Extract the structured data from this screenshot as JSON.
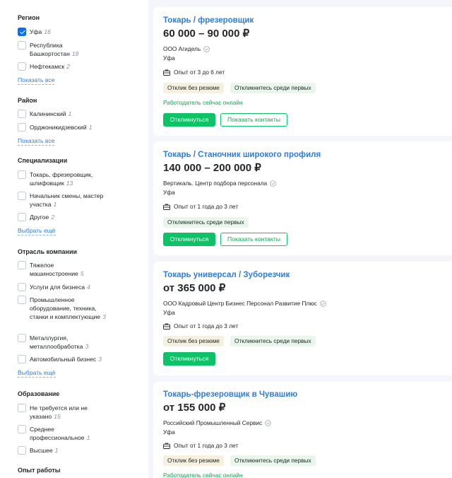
{
  "filters": {
    "region": {
      "title": "Регион",
      "options": [
        {
          "label": "Уфа",
          "count": "16",
          "checked": true
        },
        {
          "label": "Республика Башкортостан",
          "count": "18",
          "checked": false
        },
        {
          "label": "Нефтекамск",
          "count": "2",
          "checked": false
        }
      ],
      "more_label": "Показать все"
    },
    "district": {
      "title": "Район",
      "options": [
        {
          "label": "Калининский",
          "count": "1",
          "checked": false
        },
        {
          "label": "Орджоникидзевский",
          "count": "1",
          "checked": false
        }
      ],
      "more_label": "Показать все"
    },
    "specialization": {
      "title": "Специализации",
      "options": [
        {
          "label": "Токарь, фрезеровщик, шлифовщик",
          "count": "13",
          "checked": false
        },
        {
          "label": "Начальник смены, мастер участка",
          "count": "1",
          "checked": false
        },
        {
          "label": "Другое",
          "count": "2",
          "checked": false
        }
      ],
      "more_label": "Выбрать ещё"
    },
    "industry": {
      "title": "Отрасль компании",
      "options": [
        {
          "label": "Тяжелое машиностроение",
          "count": "5",
          "checked": false
        },
        {
          "label": "Услуги для бизнеса",
          "count": "4",
          "checked": false
        },
        {
          "label": "Промышленное оборудование, техника, станки и комплектующие",
          "count": "3",
          "checked": false
        },
        {
          "label": "Металлургия, металлообработка",
          "count": "3",
          "checked": false
        },
        {
          "label": "Автомобильный бизнес",
          "count": "3",
          "checked": false
        }
      ],
      "more_label": "Выбрать ещё"
    },
    "education": {
      "title": "Образование",
      "options": [
        {
          "label": "Не требуется или не указано",
          "count": "15",
          "checked": false
        },
        {
          "label": "Среднее профессиональное",
          "count": "1",
          "checked": false
        },
        {
          "label": "Высшее",
          "count": "1",
          "checked": false
        }
      ]
    },
    "experience": {
      "title": "Опыт работы"
    }
  },
  "vacancies": [
    {
      "title": "Токарь / фрезеровщик",
      "salary": "60 000 – 90 000 ₽",
      "company": "ООО Агидель",
      "city": "Уфа",
      "experience": "Опыт от 3 до 6 лет",
      "tags": [
        "Отклик без резюме",
        "Откликнитесь среди первых"
      ],
      "online": "Работодатель сейчас онлайн",
      "apply_label": "Откликнуться",
      "contacts_label": "Показать контакты"
    },
    {
      "title": "Токарь / Станочник широкого профиля",
      "salary": "140 000 – 200 000 ₽",
      "company": "Вертикаль. Центр подбора персонала",
      "city": "Уфа",
      "experience": "Опыт от 1 года до 3 лет",
      "tags": [
        "Откликнитесь среди первых"
      ],
      "apply_label": "Откликнуться",
      "contacts_label": "Показать контакты"
    },
    {
      "title": "Токарь универсал / Зуборезчик",
      "salary": "от 365 000 ₽",
      "company": "ООО Кадровый Центр Бизнес Персонал Развитие Плюс",
      "city": "Уфа",
      "experience": "Опыт от 1 года до 3 лет",
      "tags": [
        "Отклик без резюме",
        "Откликнитесь среди первых"
      ],
      "apply_label": "Откликнуться"
    },
    {
      "title": "Токарь-фрезеровщик в Чувашию",
      "salary": "от 155 000 ₽",
      "company": "Российский Промышленный Сервис",
      "city": "Уфа",
      "experience": "Опыт от 1 года до 3 лет",
      "tags": [
        "Отклик без резюме",
        "Откликнитесь среди первых"
      ],
      "online": "Работодатель сейчас онлайн"
    }
  ],
  "colors": {
    "link": "#2d7de0",
    "primary_button": "#0dc267",
    "online": "#0aa84b",
    "checkbox_checked": "#0a6ff0"
  }
}
